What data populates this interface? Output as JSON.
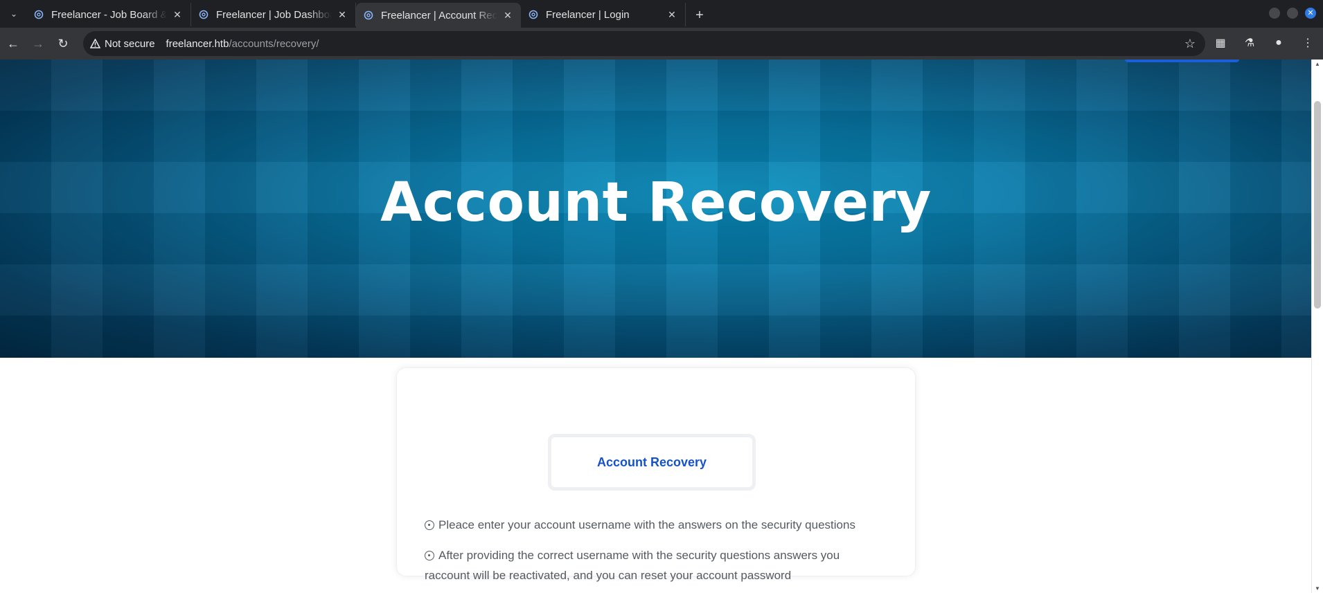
{
  "browser": {
    "tabs": [
      {
        "title": "Freelancer - Job Board &",
        "active": false
      },
      {
        "title": "Freelancer | Job Dashboard",
        "active": false
      },
      {
        "title": "Freelancer | Account Recovery",
        "active": true
      },
      {
        "title": "Freelancer | Login",
        "active": false
      }
    ],
    "security_label": "Not secure",
    "url_host": "freelancer.htb",
    "url_path": "/accounts/recovery/"
  },
  "hero": {
    "heading": "Account Recovery"
  },
  "card": {
    "tab_label": "Account Recovery",
    "info": [
      "Pleace enter your account username with the answers on the security questions",
      "After providing the correct username with the security questions answers you raccount will be reactivated, and you can reset your account password"
    ]
  },
  "colors": {
    "accent": "#1552c8",
    "hero_center": "#0a8fbf",
    "hero_edge": "#022b46"
  },
  "icons": {
    "tab_favicon": "gear-favicon-icon",
    "back": "arrow-left-icon",
    "forward": "arrow-right-icon",
    "reload": "reload-icon",
    "warning": "warning-triangle-icon",
    "bookmark": "star-icon",
    "extensions": "puzzle-icon",
    "labs": "flask-icon",
    "profile": "person-icon",
    "menu": "kebab-menu-icon"
  }
}
